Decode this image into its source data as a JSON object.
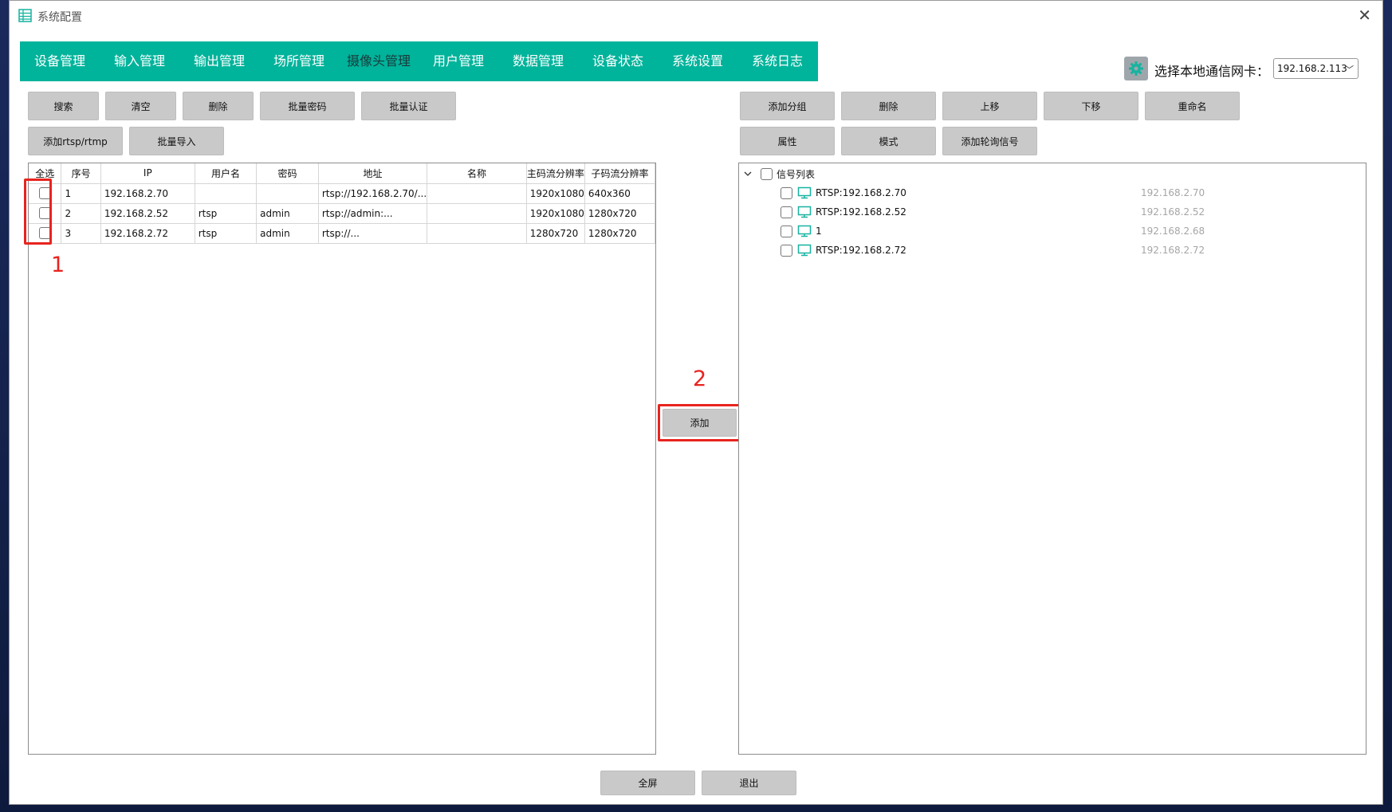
{
  "window": {
    "title": "系统配置"
  },
  "nav": {
    "tabs": [
      {
        "label": "设备管理",
        "active": false
      },
      {
        "label": "输入管理",
        "active": false
      },
      {
        "label": "输出管理",
        "active": false
      },
      {
        "label": "场所管理",
        "active": false
      },
      {
        "label": "摄像头管理",
        "active": true
      },
      {
        "label": "用户管理",
        "active": false
      },
      {
        "label": "数据管理",
        "active": false
      },
      {
        "label": "设备状态",
        "active": false
      },
      {
        "label": "系统设置",
        "active": false
      },
      {
        "label": "系统日志",
        "active": false
      }
    ]
  },
  "nic": {
    "label": "选择本地通信网卡：",
    "selected": "192.168.2.113"
  },
  "left_toolbar": {
    "row1": [
      "搜索",
      "清空",
      "删除",
      "批量密码",
      "批量认证"
    ],
    "row2": [
      "添加rtsp/rtmp",
      "批量导入"
    ]
  },
  "right_toolbar": {
    "row1": [
      "添加分组",
      "删除",
      "上移",
      "下移",
      "重命名"
    ],
    "row2": [
      "属性",
      "模式",
      "添加轮询信号"
    ]
  },
  "camera_table": {
    "columns": [
      "全选",
      "序号",
      "IP",
      "用户名",
      "密码",
      "地址",
      "名称",
      "主码流分辨率",
      "子码流分辨率"
    ],
    "rows": [
      {
        "index": "1",
        "ip": "192.168.2.70",
        "user": "",
        "password": "",
        "address": "rtsp://192.168.2.70/...",
        "name": "",
        "main_res": "1920x1080",
        "sub_res": "640x360"
      },
      {
        "index": "2",
        "ip": "192.168.2.52",
        "user": "rtsp",
        "password": "admin",
        "address": "rtsp://admin:...",
        "name": "",
        "main_res": "1920x1080",
        "sub_res": "1280x720"
      },
      {
        "index": "3",
        "ip": "192.168.2.72",
        "user": "rtsp",
        "password": "admin",
        "address": "rtsp://...",
        "name": "",
        "main_res": "1280x720",
        "sub_res": "1280x720"
      }
    ]
  },
  "add_button": "添加",
  "signal_tree": {
    "root": "信号列表",
    "items": [
      {
        "label": "RTSP:192.168.2.70",
        "ip": "192.168.2.70"
      },
      {
        "label": "RTSP:192.168.2.52",
        "ip": "192.168.2.52"
      },
      {
        "label": "1",
        "ip": "192.168.2.68"
      },
      {
        "label": "RTSP:192.168.2.72",
        "ip": "192.168.2.72"
      }
    ]
  },
  "bottom_buttons": {
    "fullscreen": "全屏",
    "exit": "退出"
  },
  "annotations": {
    "step1": "1",
    "step2": "2"
  },
  "colors": {
    "nav_bg": "#00b39b",
    "annotation": "#e8231e",
    "button_bg": "#c9c9c9",
    "monitor_icon": "#17b3a0"
  }
}
